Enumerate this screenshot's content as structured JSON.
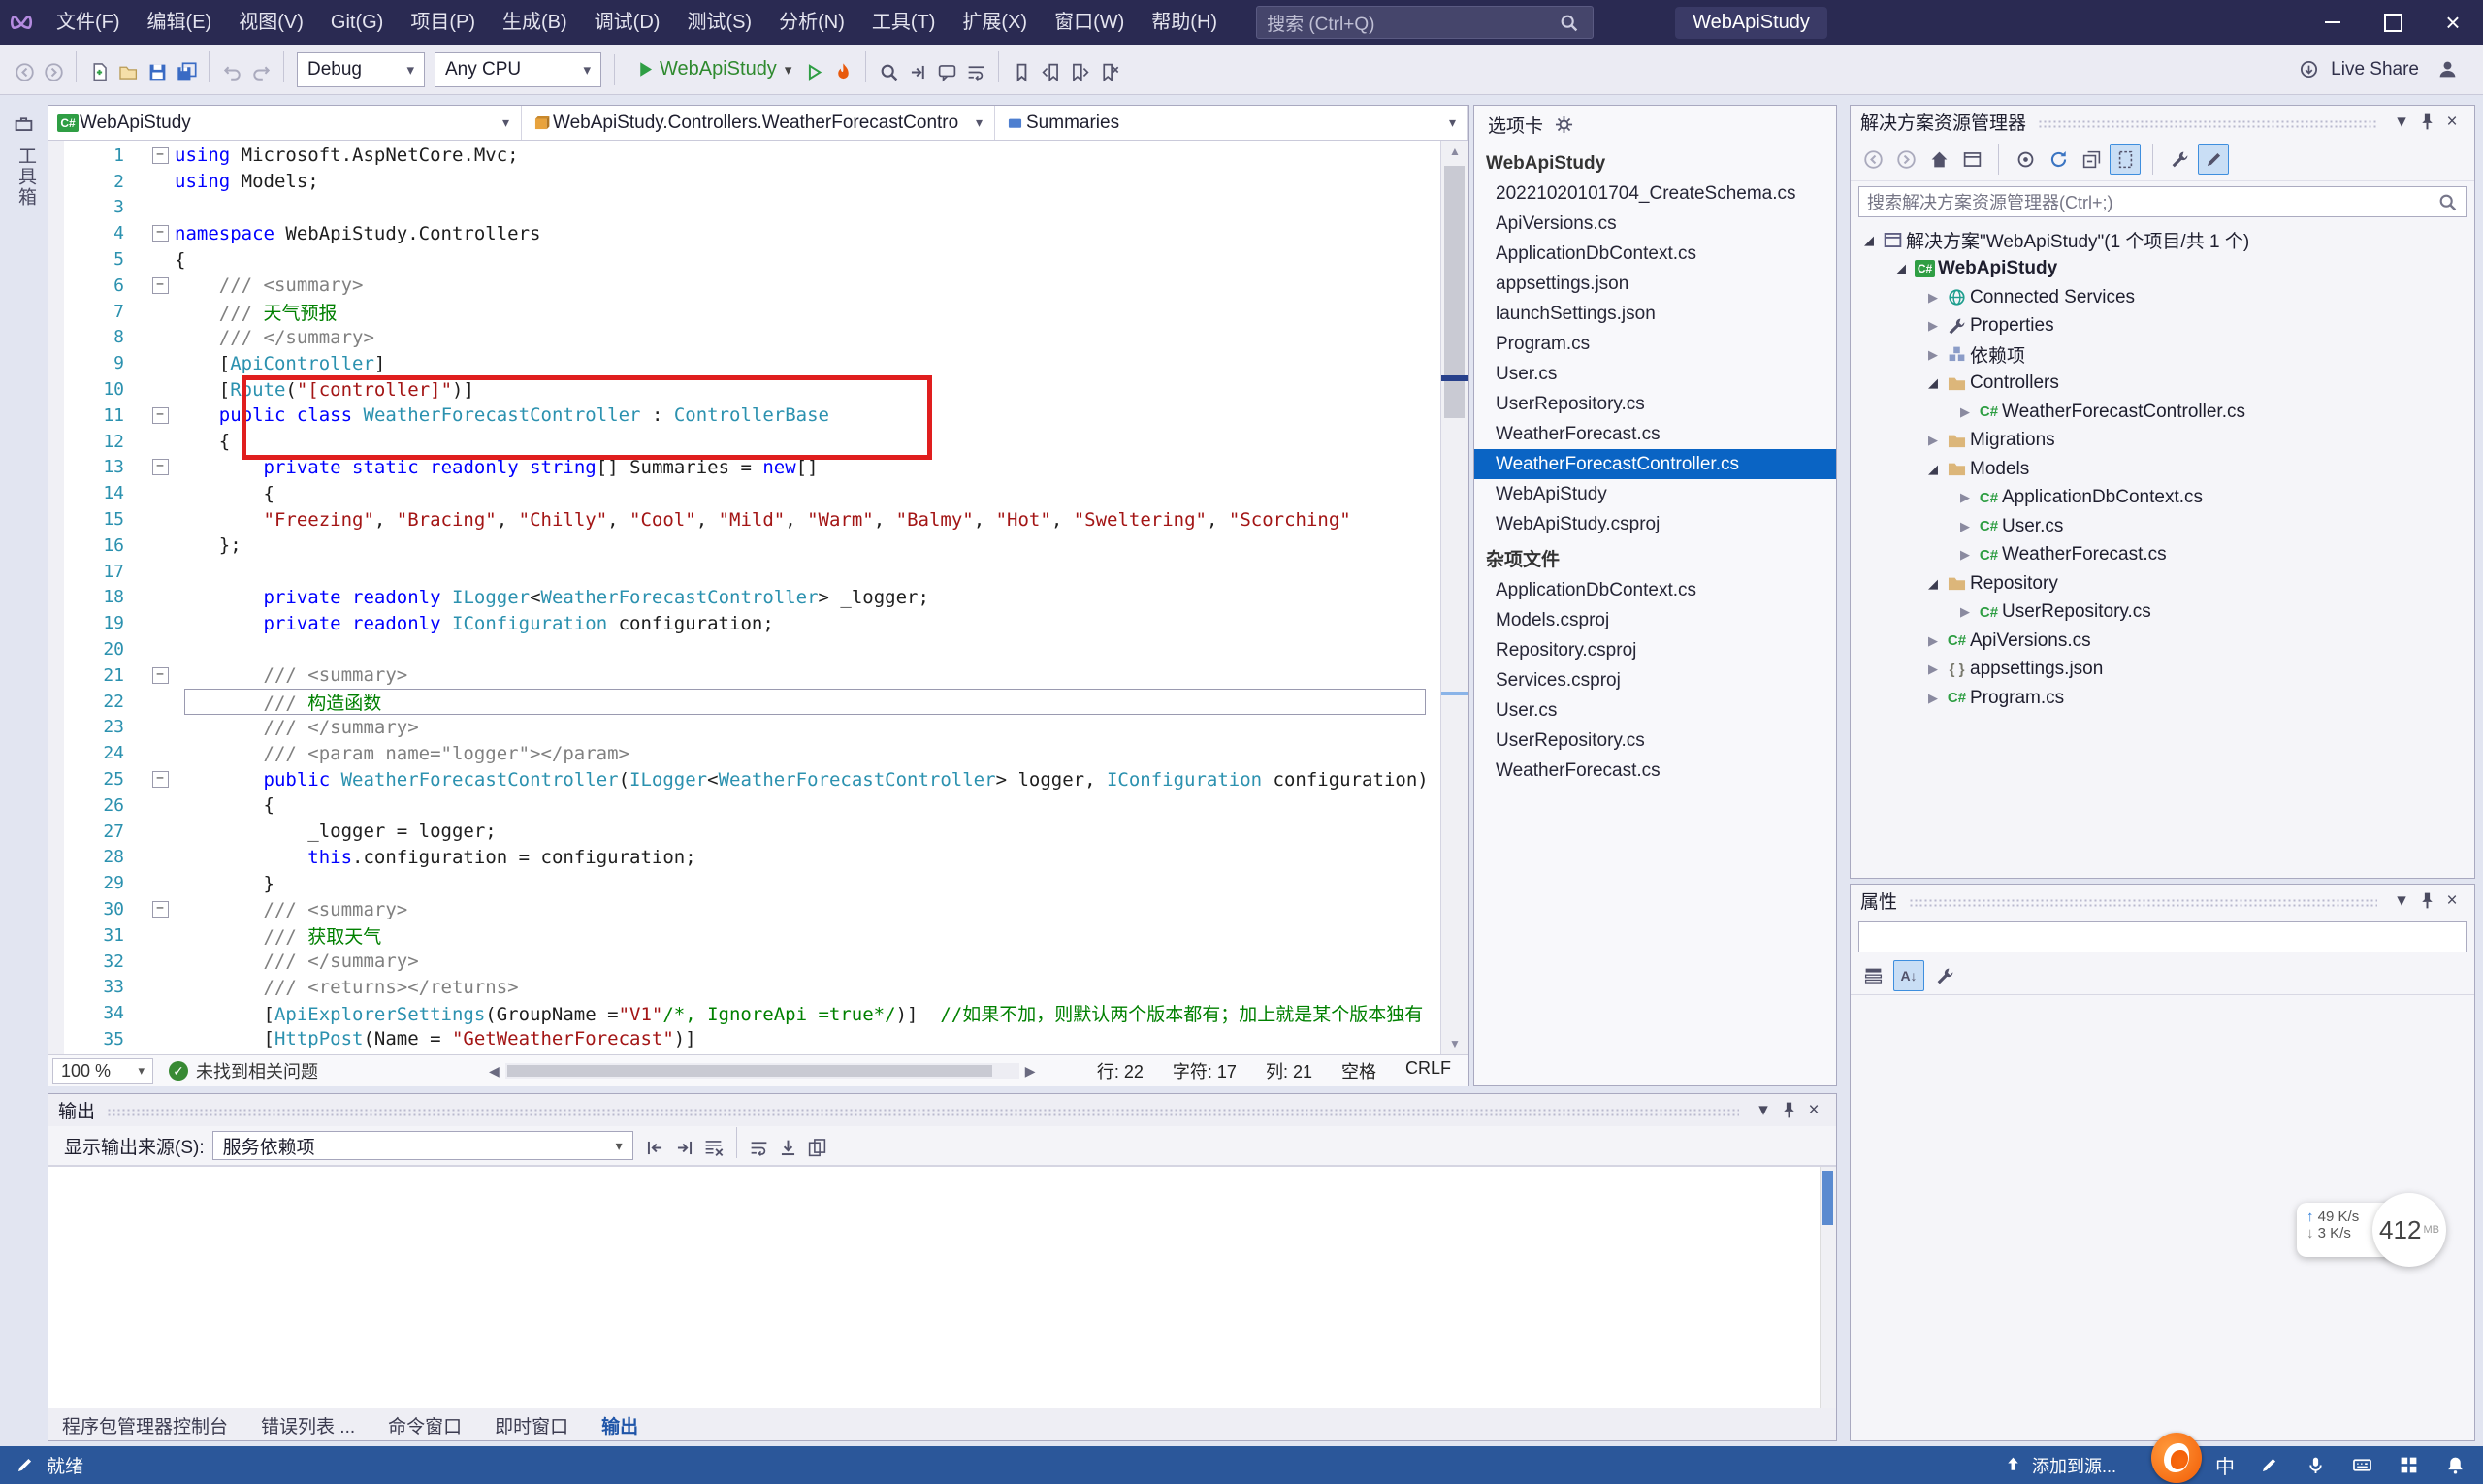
{
  "title_bar": {
    "menus": [
      "文件(F)",
      "编辑(E)",
      "视图(V)",
      "Git(G)",
      "项目(P)",
      "生成(B)",
      "调试(D)",
      "测试(S)",
      "分析(N)",
      "工具(T)",
      "扩展(X)",
      "窗口(W)",
      "帮助(H)"
    ],
    "search_placeholder": "搜索 (Ctrl+Q)",
    "window_title": "WebApiStudy"
  },
  "toolbar": {
    "config": "Debug",
    "platform": "Any CPU",
    "run_project": "WebApiStudy",
    "live_share": "Live Share",
    "left_icons": [
      {
        "n": "nav-back-icon",
        "dim": true
      },
      {
        "n": "nav-forward-icon",
        "dim": true
      },
      "sep",
      "new-project-icon",
      "open-folder-icon",
      "save-icon",
      "save-all-icon",
      "sep",
      {
        "n": "undo-icon",
        "dim": true
      },
      {
        "n": "redo-icon",
        "dim": true
      },
      "sep"
    ],
    "mid_icons": [
      "start-without-debugging-icon",
      "hot-reload-icon",
      "sep",
      "find-icon",
      "navigate-icon",
      "comment-icon",
      "word-wrap-icon",
      "sep",
      "bookmark-icon",
      "bookmark-prev-icon",
      "bookmark-next-icon",
      "bookmark-clear-icon"
    ]
  },
  "left_strip": {
    "toolbox_label": "工具箱"
  },
  "editor": {
    "nav": [
      {
        "label": "WebApiStudy",
        "icon": "project"
      },
      {
        "label": "WebApiStudy.Controllers.WeatherForecastContro",
        "icon": "class"
      },
      {
        "label": "Summaries",
        "icon": "field"
      }
    ],
    "zoom": "100 %",
    "health": "未找到相关问题",
    "pos": {
      "line": "行: 22",
      "char": "字符: 17",
      "col": "列: 21",
      "space": "空格",
      "eol": "CRLF"
    },
    "code_lines": [
      {
        "n": 1,
        "fold": true,
        "seg": [
          [
            "kw",
            "using"
          ],
          [
            "pl",
            " Microsoft.AspNetCore.Mvc;"
          ]
        ]
      },
      {
        "n": 2,
        "seg": [
          [
            "kw",
            "using"
          ],
          [
            "pl",
            " Models;"
          ]
        ]
      },
      {
        "n": 3,
        "seg": []
      },
      {
        "n": 4,
        "fold": true,
        "seg": [
          [
            "kw",
            "namespace"
          ],
          [
            "pl",
            " WebApiStudy.Controllers"
          ]
        ]
      },
      {
        "n": 5,
        "seg": [
          [
            "pl",
            "{"
          ]
        ]
      },
      {
        "n": 6,
        "fold": true,
        "seg": [
          [
            "doc",
            "    /// <summary>"
          ]
        ]
      },
      {
        "n": 7,
        "seg": [
          [
            "doc",
            "    /// "
          ],
          [
            "cm",
            "天气预报"
          ]
        ]
      },
      {
        "n": 8,
        "seg": [
          [
            "doc",
            "    /// </summary>"
          ]
        ]
      },
      {
        "n": 9,
        "seg": [
          [
            "pl",
            "    ["
          ],
          [
            "ty",
            "ApiController"
          ],
          [
            "pl",
            "]"
          ]
        ]
      },
      {
        "n": 10,
        "seg": [
          [
            "pl",
            "    ["
          ],
          [
            "ty",
            "Route"
          ],
          [
            "pl",
            "("
          ],
          [
            "str",
            "\"[controller]\""
          ],
          [
            "pl",
            ")]"
          ]
        ]
      },
      {
        "n": 11,
        "fold": true,
        "seg": [
          [
            "pl",
            "    "
          ],
          [
            "kw",
            "public"
          ],
          [
            "pl",
            " "
          ],
          [
            "kw",
            "class"
          ],
          [
            "pl",
            " "
          ],
          [
            "ty",
            "WeatherForecastController"
          ],
          [
            "pl",
            " : "
          ],
          [
            "ty",
            "ControllerBase"
          ]
        ]
      },
      {
        "n": 12,
        "seg": [
          [
            "pl",
            "    {"
          ]
        ]
      },
      {
        "n": 13,
        "fold": true,
        "seg": [
          [
            "pl",
            "        "
          ],
          [
            "kw",
            "private"
          ],
          [
            "pl",
            " "
          ],
          [
            "kw",
            "static"
          ],
          [
            "pl",
            " "
          ],
          [
            "kw",
            "readonly"
          ],
          [
            "pl",
            " "
          ],
          [
            "kw",
            "string"
          ],
          [
            "pl",
            "[] Summaries = "
          ],
          [
            "kw",
            "new"
          ],
          [
            "pl",
            "[]"
          ]
        ]
      },
      {
        "n": 14,
        "seg": [
          [
            "pl",
            "        {"
          ]
        ]
      },
      {
        "n": 15,
        "seg": [
          [
            "pl",
            "        "
          ],
          [
            "str",
            "\"Freezing\""
          ],
          [
            "pl",
            ", "
          ],
          [
            "str",
            "\"Bracing\""
          ],
          [
            "pl",
            ", "
          ],
          [
            "str",
            "\"Chilly\""
          ],
          [
            "pl",
            ", "
          ],
          [
            "str",
            "\"Cool\""
          ],
          [
            "pl",
            ", "
          ],
          [
            "str",
            "\"Mild\""
          ],
          [
            "pl",
            ", "
          ],
          [
            "str",
            "\"Warm\""
          ],
          [
            "pl",
            ", "
          ],
          [
            "str",
            "\"Balmy\""
          ],
          [
            "pl",
            ", "
          ],
          [
            "str",
            "\"Hot\""
          ],
          [
            "pl",
            ", "
          ],
          [
            "str",
            "\"Sweltering\""
          ],
          [
            "pl",
            ", "
          ],
          [
            "str",
            "\"Scorching\""
          ]
        ]
      },
      {
        "n": 16,
        "seg": [
          [
            "pl",
            "    };"
          ]
        ]
      },
      {
        "n": 17,
        "seg": []
      },
      {
        "n": 18,
        "seg": [
          [
            "pl",
            "        "
          ],
          [
            "kw",
            "private"
          ],
          [
            "pl",
            " "
          ],
          [
            "kw",
            "readonly"
          ],
          [
            "pl",
            " "
          ],
          [
            "ty",
            "ILogger"
          ],
          [
            "pl",
            "<"
          ],
          [
            "ty",
            "WeatherForecastController"
          ],
          [
            "pl",
            "> _logger;"
          ]
        ]
      },
      {
        "n": 19,
        "seg": [
          [
            "pl",
            "        "
          ],
          [
            "kw",
            "private"
          ],
          [
            "pl",
            " "
          ],
          [
            "kw",
            "readonly"
          ],
          [
            "pl",
            " "
          ],
          [
            "ty",
            "IConfiguration"
          ],
          [
            "pl",
            " configuration;"
          ]
        ]
      },
      {
        "n": 20,
        "seg": []
      },
      {
        "n": 21,
        "fold": true,
        "seg": [
          [
            "doc",
            "        /// <summary>"
          ]
        ]
      },
      {
        "n": 22,
        "cur": true,
        "seg": [
          [
            "doc",
            "        /// "
          ],
          [
            "cm",
            "构造函数"
          ]
        ]
      },
      {
        "n": 23,
        "seg": [
          [
            "doc",
            "        /// </summary>"
          ]
        ]
      },
      {
        "n": 24,
        "seg": [
          [
            "doc",
            "        /// <param name=\"logger\"></param>"
          ]
        ]
      },
      {
        "n": 25,
        "fold": true,
        "seg": [
          [
            "pl",
            "        "
          ],
          [
            "kw",
            "public"
          ],
          [
            "pl",
            " "
          ],
          [
            "ty",
            "WeatherForecastController"
          ],
          [
            "pl",
            "("
          ],
          [
            "ty",
            "ILogger"
          ],
          [
            "pl",
            "<"
          ],
          [
            "ty",
            "WeatherForecastController"
          ],
          [
            "pl",
            "> logger, "
          ],
          [
            "ty",
            "IConfiguration"
          ],
          [
            "pl",
            " configuration)"
          ]
        ]
      },
      {
        "n": 26,
        "seg": [
          [
            "pl",
            "        {"
          ]
        ]
      },
      {
        "n": 27,
        "seg": [
          [
            "pl",
            "            _logger = logger;"
          ]
        ]
      },
      {
        "n": 28,
        "seg": [
          [
            "pl",
            "            "
          ],
          [
            "kw",
            "this"
          ],
          [
            "pl",
            ".configuration = configuration;"
          ]
        ]
      },
      {
        "n": 29,
        "seg": [
          [
            "pl",
            "        }"
          ]
        ]
      },
      {
        "n": 30,
        "fold": true,
        "seg": [
          [
            "doc",
            "        /// <summary>"
          ]
        ]
      },
      {
        "n": 31,
        "seg": [
          [
            "doc",
            "        /// "
          ],
          [
            "cm",
            "获取天气"
          ]
        ]
      },
      {
        "n": 32,
        "seg": [
          [
            "doc",
            "        /// </summary>"
          ]
        ]
      },
      {
        "n": 33,
        "seg": [
          [
            "doc",
            "        /// <returns></returns>"
          ]
        ]
      },
      {
        "n": 34,
        "seg": [
          [
            "pl",
            "        ["
          ],
          [
            "ty",
            "ApiExplorerSettings"
          ],
          [
            "pl",
            "(GroupName ="
          ],
          [
            "str",
            "\"V1\""
          ],
          [
            "cm",
            "/*, IgnoreApi =true*/"
          ],
          [
            "pl",
            ")]  "
          ],
          [
            "cm",
            "//如果不加，则默认两个版本都有；加上就是某个版本独有"
          ]
        ]
      },
      {
        "n": 35,
        "seg": [
          [
            "pl",
            "        ["
          ],
          [
            "ty",
            "HttpPost"
          ],
          [
            "pl",
            "(Name = "
          ],
          [
            "str",
            "\"GetWeatherForecast\""
          ],
          [
            "pl",
            ")]"
          ]
        ]
      }
    ]
  },
  "tabs_panel": {
    "title": "选项卡",
    "groups": [
      {
        "header": "WebApiStudy",
        "items": [
          {
            "label": "20221020101704_CreateSchema.cs"
          },
          {
            "label": "ApiVersions.cs"
          },
          {
            "label": "ApplicationDbContext.cs"
          },
          {
            "label": "appsettings.json"
          },
          {
            "label": "launchSettings.json"
          },
          {
            "label": "Program.cs"
          },
          {
            "label": "User.cs"
          },
          {
            "label": "UserRepository.cs"
          },
          {
            "label": "WeatherForecast.cs"
          },
          {
            "label": "WeatherForecastController.cs",
            "selected": true
          },
          {
            "label": "WebApiStudy"
          },
          {
            "label": "WebApiStudy.csproj"
          }
        ]
      },
      {
        "header": "杂项文件",
        "items": [
          {
            "label": "ApplicationDbContext.cs"
          },
          {
            "label": "Models.csproj"
          },
          {
            "label": "Repository.csproj"
          },
          {
            "label": "Services.csproj"
          },
          {
            "label": "User.cs"
          },
          {
            "label": "UserRepository.cs"
          },
          {
            "label": "WeatherForecast.cs"
          }
        ]
      }
    ]
  },
  "solution_explorer": {
    "title": "解决方案资源管理器",
    "search_placeholder": "搜索解决方案资源管理器(Ctrl+;)",
    "toolbar_icons": [
      {
        "n": "nav-back-icon",
        "dim": true
      },
      {
        "n": "nav-forward-icon",
        "dim": true
      },
      "home-icon",
      "switch-views-icon",
      "sep",
      "sync-active-icon",
      "refresh-icon",
      "collapse-all-icon",
      {
        "n": "show-all-files-icon",
        "pressed": true
      },
      "sep",
      "wrench-icon",
      {
        "n": "pencil-icon",
        "pressed": true
      }
    ],
    "tree": [
      {
        "label": "解决方案\"WebApiStudy\"(1 个项目/共 1 个)",
        "icon": "solution",
        "arrow": "exp",
        "level": 0
      },
      {
        "label": "WebApiStudy",
        "icon": "project",
        "arrow": "exp",
        "level": 1,
        "bold": true
      },
      {
        "label": "Connected Services",
        "icon": "connected",
        "arrow": "col",
        "level": 2
      },
      {
        "label": "Properties",
        "icon": "wrench",
        "arrow": "col",
        "level": 2
      },
      {
        "label": "依赖项",
        "icon": "dependencies",
        "arrow": "col",
        "level": 2
      },
      {
        "label": "Controllers",
        "icon": "folder",
        "arrow": "exp",
        "level": 2
      },
      {
        "label": "WeatherForecastController.cs",
        "icon": "cs",
        "arrow": "col",
        "level": 3
      },
      {
        "label": "Migrations",
        "icon": "folder",
        "arrow": "col",
        "level": 2
      },
      {
        "label": "Models",
        "icon": "folder",
        "arrow": "exp",
        "level": 2
      },
      {
        "label": "ApplicationDbContext.cs",
        "icon": "cs",
        "arrow": "col",
        "level": 3
      },
      {
        "label": "User.cs",
        "icon": "cs",
        "arrow": "col",
        "level": 3
      },
      {
        "label": "WeatherForecast.cs",
        "icon": "cs",
        "arrow": "col",
        "level": 3
      },
      {
        "label": "Repository",
        "icon": "folder",
        "arrow": "exp",
        "level": 2
      },
      {
        "label": "UserRepository.cs",
        "icon": "cs",
        "arrow": "col",
        "level": 3
      },
      {
        "label": "ApiVersions.cs",
        "icon": "cs",
        "arrow": "col",
        "level": 2
      },
      {
        "label": "appsettings.json",
        "icon": "json",
        "arrow": "col",
        "level": 2
      },
      {
        "label": "Program.cs",
        "icon": "cs",
        "arrow": "col",
        "level": 2
      }
    ]
  },
  "properties_panel": {
    "title": "属性",
    "toolbar_icons": [
      "categorized-icon",
      {
        "n": "alphabetical-icon",
        "pressed": true
      },
      "wrench-icon"
    ]
  },
  "output_panel": {
    "title": "输出",
    "source_label": "显示输出来源(S):",
    "source_value": "服务依赖项",
    "toolbar_icons": [
      "goto-prev-icon",
      "goto-next-icon",
      "clear-all-icon",
      "sep",
      "word-wrap-icon",
      "autoscroll-icon",
      "copy-icon"
    ],
    "bottom_tabs": [
      "程序包管理器控制台",
      "错误列表 ...",
      "命令窗口",
      "即时窗口",
      "输出"
    ],
    "active_tab_index": 4
  },
  "status_bar": {
    "ready": "就绪",
    "add_to_source": "添加到源...",
    "ime": "中",
    "right_icons": [
      "pen-icon",
      "microphone-icon",
      "keyboard-icon",
      "input-grid-icon",
      "bell-icon"
    ]
  },
  "overlays": {
    "net_up": "49 K/s",
    "net_down": "3 K/s",
    "memory": "412",
    "memory_unit": "MB"
  }
}
